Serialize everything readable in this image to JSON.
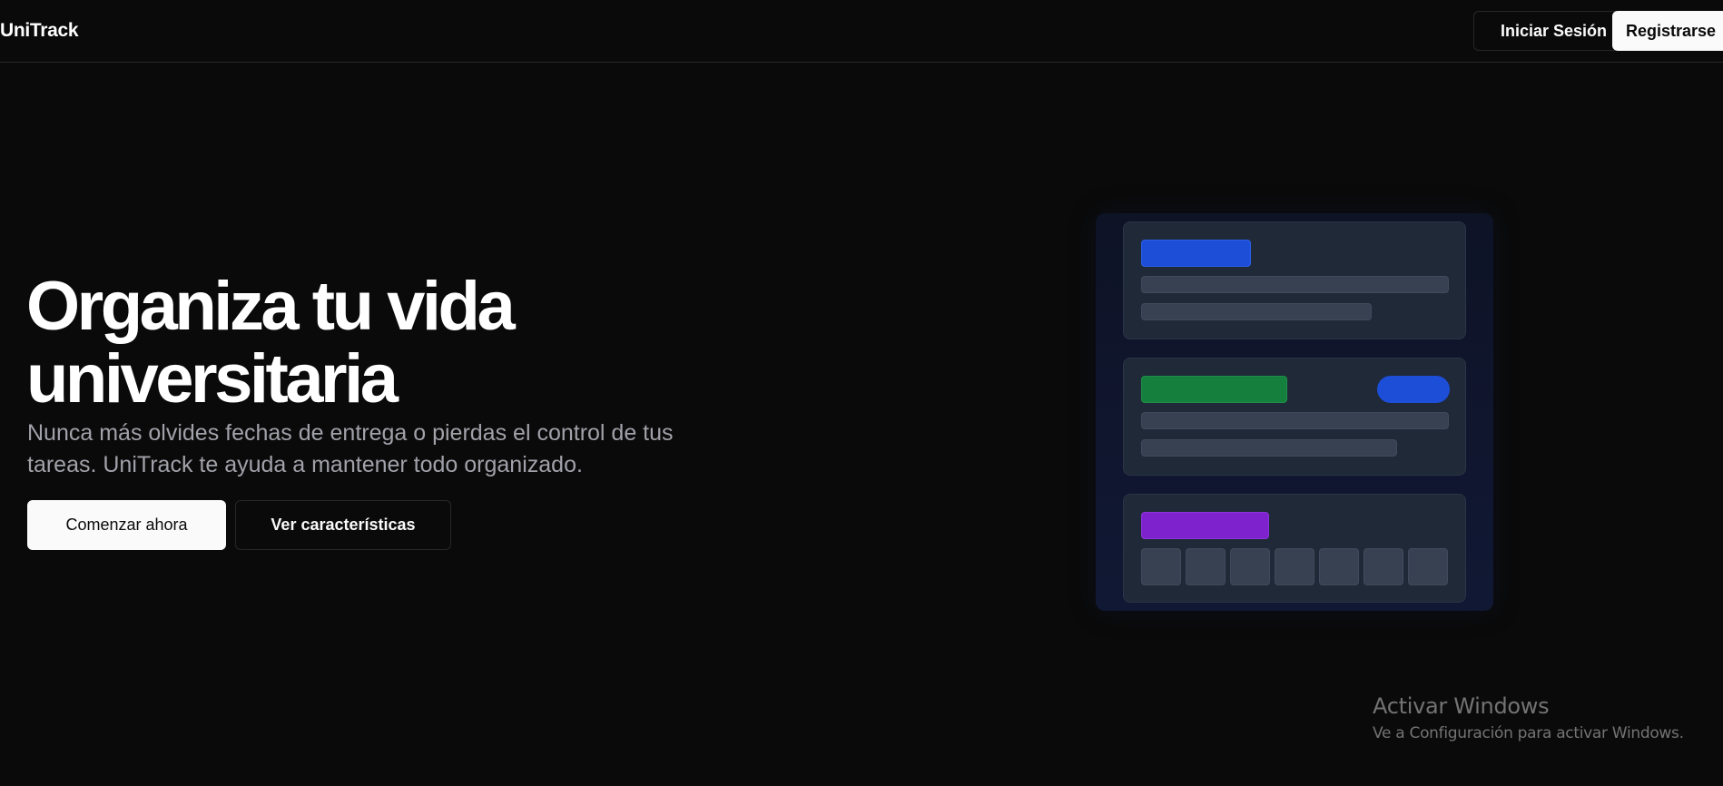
{
  "header": {
    "logo": "UniTrack",
    "login_label": "Iniciar Sesión",
    "register_label": "Registrarse"
  },
  "hero": {
    "title": "Organiza tu vida universitaria",
    "subtitle": "Nunca más olvides fechas de entrega o pierdas el control de tus tareas. UniTrack te ayuda a mantener todo organizado.",
    "primary_cta": "Comenzar ahora",
    "secondary_cta": "Ver características"
  },
  "illustration": {
    "colors": {
      "blue": "#1d4ed8",
      "green": "#15803d",
      "purple": "#7e22ce",
      "card": "#1f2937",
      "placeholder": "#374151"
    }
  },
  "watermark": {
    "title": "Activar Windows",
    "subtitle": "Ve a Configuración para activar Windows."
  },
  "colors": {
    "background": "#0a0a0a",
    "foreground": "#fafafa",
    "muted": "#a1a1aa",
    "border": "#27272a"
  }
}
